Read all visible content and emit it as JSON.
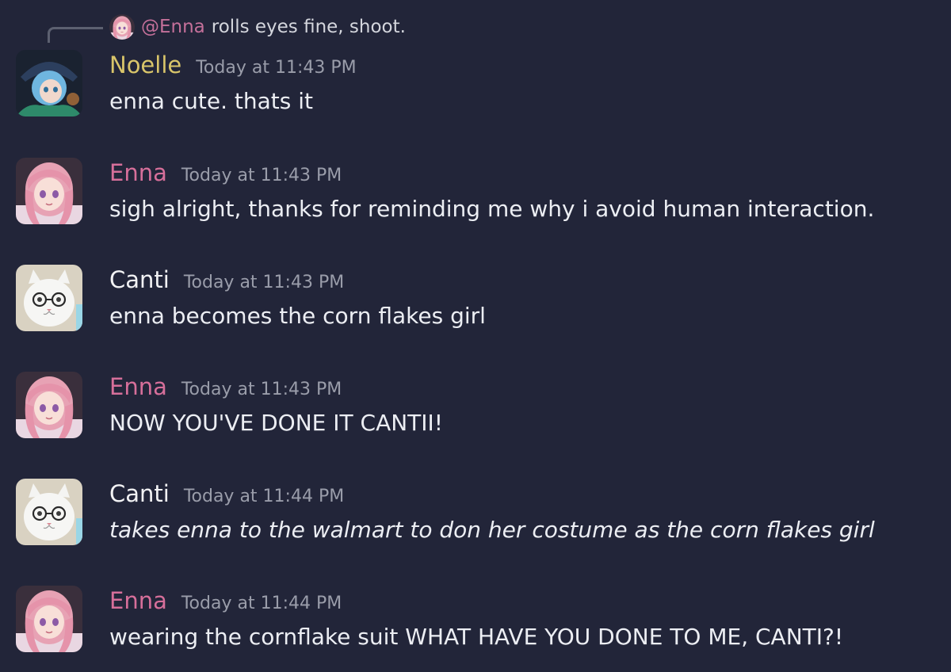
{
  "colors": {
    "background": "#222539",
    "noelle": "#d9c56a",
    "enna": "#d66f9a",
    "canti": "#f2f2f4",
    "timestamp": "#9a9daa",
    "text": "#eceef3",
    "mention": "#c4709a"
  },
  "reply": {
    "avatar_icon": "enna-avatar-icon",
    "mention": "@Enna",
    "text": "rolls eyes fine, shoot."
  },
  "messages": [
    {
      "author": "Noelle",
      "timestamp": "Today at 11:43 PM",
      "content": "enna cute. thats it",
      "avatar_icon": "noelle-avatar-icon"
    },
    {
      "author": "Enna",
      "timestamp": "Today at 11:43 PM",
      "content": "sigh alright, thanks for reminding me why i avoid human interaction.",
      "avatar_icon": "enna-avatar-icon"
    },
    {
      "author": "Canti",
      "timestamp": "Today at 11:43 PM",
      "content": "enna becomes the corn flakes girl",
      "avatar_icon": "canti-avatar-icon"
    },
    {
      "author": "Enna",
      "timestamp": "Today at 11:43 PM",
      "content": "NOW YOU'VE DONE IT CANTII!",
      "avatar_icon": "enna-avatar-icon"
    },
    {
      "author": "Canti",
      "timestamp": "Today at 11:44 PM",
      "content": "takes enna to the walmart to don her costume as the corn flakes girl",
      "avatar_icon": "canti-avatar-icon"
    },
    {
      "author": "Enna",
      "timestamp": "Today at 11:44 PM",
      "content": "wearing the cornflake suit WHAT HAVE YOU DONE TO ME, CANTI?!",
      "avatar_icon": "enna-avatar-icon"
    }
  ]
}
